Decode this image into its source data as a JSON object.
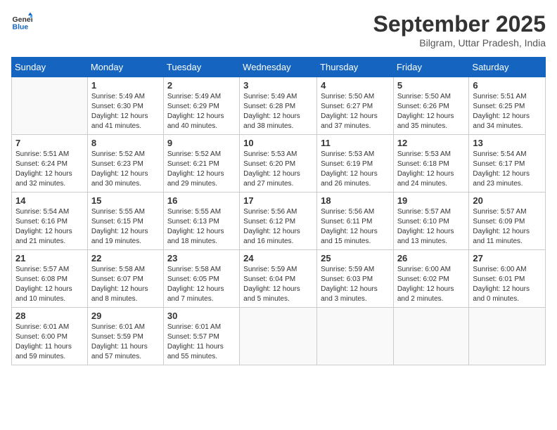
{
  "header": {
    "logo_line1": "General",
    "logo_line2": "Blue",
    "month_title": "September 2025",
    "subtitle": "Bilgram, Uttar Pradesh, India"
  },
  "days_of_week": [
    "Sunday",
    "Monday",
    "Tuesday",
    "Wednesday",
    "Thursday",
    "Friday",
    "Saturday"
  ],
  "weeks": [
    [
      {
        "day": "",
        "info": ""
      },
      {
        "day": "1",
        "info": "Sunrise: 5:49 AM\nSunset: 6:30 PM\nDaylight: 12 hours\nand 41 minutes."
      },
      {
        "day": "2",
        "info": "Sunrise: 5:49 AM\nSunset: 6:29 PM\nDaylight: 12 hours\nand 40 minutes."
      },
      {
        "day": "3",
        "info": "Sunrise: 5:49 AM\nSunset: 6:28 PM\nDaylight: 12 hours\nand 38 minutes."
      },
      {
        "day": "4",
        "info": "Sunrise: 5:50 AM\nSunset: 6:27 PM\nDaylight: 12 hours\nand 37 minutes."
      },
      {
        "day": "5",
        "info": "Sunrise: 5:50 AM\nSunset: 6:26 PM\nDaylight: 12 hours\nand 35 minutes."
      },
      {
        "day": "6",
        "info": "Sunrise: 5:51 AM\nSunset: 6:25 PM\nDaylight: 12 hours\nand 34 minutes."
      }
    ],
    [
      {
        "day": "7",
        "info": "Sunrise: 5:51 AM\nSunset: 6:24 PM\nDaylight: 12 hours\nand 32 minutes."
      },
      {
        "day": "8",
        "info": "Sunrise: 5:52 AM\nSunset: 6:23 PM\nDaylight: 12 hours\nand 30 minutes."
      },
      {
        "day": "9",
        "info": "Sunrise: 5:52 AM\nSunset: 6:21 PM\nDaylight: 12 hours\nand 29 minutes."
      },
      {
        "day": "10",
        "info": "Sunrise: 5:53 AM\nSunset: 6:20 PM\nDaylight: 12 hours\nand 27 minutes."
      },
      {
        "day": "11",
        "info": "Sunrise: 5:53 AM\nSunset: 6:19 PM\nDaylight: 12 hours\nand 26 minutes."
      },
      {
        "day": "12",
        "info": "Sunrise: 5:53 AM\nSunset: 6:18 PM\nDaylight: 12 hours\nand 24 minutes."
      },
      {
        "day": "13",
        "info": "Sunrise: 5:54 AM\nSunset: 6:17 PM\nDaylight: 12 hours\nand 23 minutes."
      }
    ],
    [
      {
        "day": "14",
        "info": "Sunrise: 5:54 AM\nSunset: 6:16 PM\nDaylight: 12 hours\nand 21 minutes."
      },
      {
        "day": "15",
        "info": "Sunrise: 5:55 AM\nSunset: 6:15 PM\nDaylight: 12 hours\nand 19 minutes."
      },
      {
        "day": "16",
        "info": "Sunrise: 5:55 AM\nSunset: 6:13 PM\nDaylight: 12 hours\nand 18 minutes."
      },
      {
        "day": "17",
        "info": "Sunrise: 5:56 AM\nSunset: 6:12 PM\nDaylight: 12 hours\nand 16 minutes."
      },
      {
        "day": "18",
        "info": "Sunrise: 5:56 AM\nSunset: 6:11 PM\nDaylight: 12 hours\nand 15 minutes."
      },
      {
        "day": "19",
        "info": "Sunrise: 5:57 AM\nSunset: 6:10 PM\nDaylight: 12 hours\nand 13 minutes."
      },
      {
        "day": "20",
        "info": "Sunrise: 5:57 AM\nSunset: 6:09 PM\nDaylight: 12 hours\nand 11 minutes."
      }
    ],
    [
      {
        "day": "21",
        "info": "Sunrise: 5:57 AM\nSunset: 6:08 PM\nDaylight: 12 hours\nand 10 minutes."
      },
      {
        "day": "22",
        "info": "Sunrise: 5:58 AM\nSunset: 6:07 PM\nDaylight: 12 hours\nand 8 minutes."
      },
      {
        "day": "23",
        "info": "Sunrise: 5:58 AM\nSunset: 6:05 PM\nDaylight: 12 hours\nand 7 minutes."
      },
      {
        "day": "24",
        "info": "Sunrise: 5:59 AM\nSunset: 6:04 PM\nDaylight: 12 hours\nand 5 minutes."
      },
      {
        "day": "25",
        "info": "Sunrise: 5:59 AM\nSunset: 6:03 PM\nDaylight: 12 hours\nand 3 minutes."
      },
      {
        "day": "26",
        "info": "Sunrise: 6:00 AM\nSunset: 6:02 PM\nDaylight: 12 hours\nand 2 minutes."
      },
      {
        "day": "27",
        "info": "Sunrise: 6:00 AM\nSunset: 6:01 PM\nDaylight: 12 hours\nand 0 minutes."
      }
    ],
    [
      {
        "day": "28",
        "info": "Sunrise: 6:01 AM\nSunset: 6:00 PM\nDaylight: 11 hours\nand 59 minutes."
      },
      {
        "day": "29",
        "info": "Sunrise: 6:01 AM\nSunset: 5:59 PM\nDaylight: 11 hours\nand 57 minutes."
      },
      {
        "day": "30",
        "info": "Sunrise: 6:01 AM\nSunset: 5:57 PM\nDaylight: 11 hours\nand 55 minutes."
      },
      {
        "day": "",
        "info": ""
      },
      {
        "day": "",
        "info": ""
      },
      {
        "day": "",
        "info": ""
      },
      {
        "day": "",
        "info": ""
      }
    ]
  ]
}
